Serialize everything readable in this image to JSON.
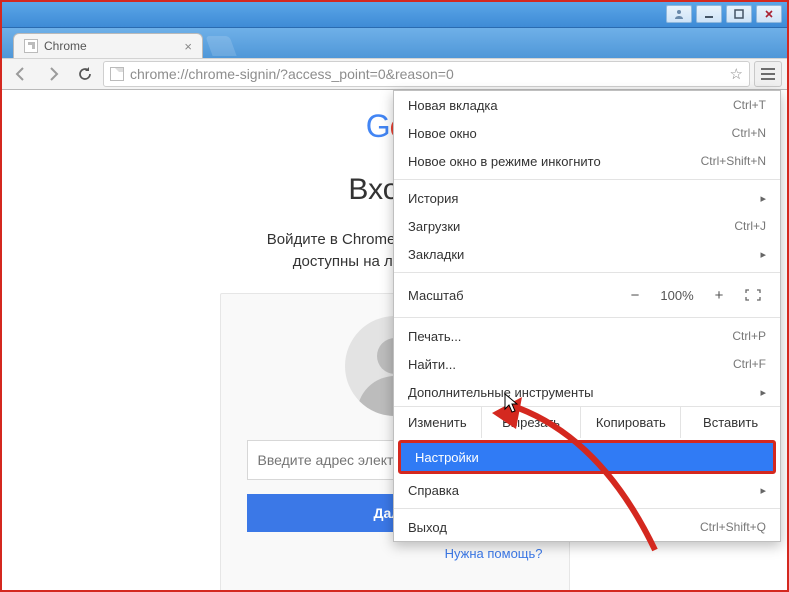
{
  "window": {
    "title": ""
  },
  "tab": {
    "label": "Chrome"
  },
  "omnibox": {
    "url": "chrome://chrome-signin/?access_point=0&reason=0"
  },
  "page": {
    "logo_text": "Goo",
    "heading": "Вход в",
    "desc_line1": "Войдите в Chrome. Все ваши заклад",
    "desc_line2": "доступны на любых устройст",
    "email_placeholder": "Введите адрес электронной почты",
    "next_btn": "Далее",
    "help": "Нужна помощь?"
  },
  "menu": {
    "new_tab": {
      "label": "Новая вкладка",
      "accel": "Ctrl+T"
    },
    "new_win": {
      "label": "Новое окно",
      "accel": "Ctrl+N"
    },
    "incognito": {
      "label": "Новое окно в режиме инкогнито",
      "accel": "Ctrl+Shift+N"
    },
    "history": {
      "label": "История"
    },
    "downloads": {
      "label": "Загрузки",
      "accel": "Ctrl+J"
    },
    "bookmarks": {
      "label": "Закладки"
    },
    "zoom_label": "Масштаб",
    "zoom_value": "100%",
    "print": {
      "label": "Печать...",
      "accel": "Ctrl+P"
    },
    "find": {
      "label": "Найти...",
      "accel": "Ctrl+F"
    },
    "more_tools": {
      "label": "Дополнительные инструменты"
    },
    "edit_label": "Изменить",
    "cut": "Вырезать",
    "copy": "Копировать",
    "paste": "Вставить",
    "settings": {
      "label": "Настройки"
    },
    "help": {
      "label": "Справка"
    },
    "exit": {
      "label": "Выход",
      "accel": "Ctrl+Shift+Q"
    }
  }
}
